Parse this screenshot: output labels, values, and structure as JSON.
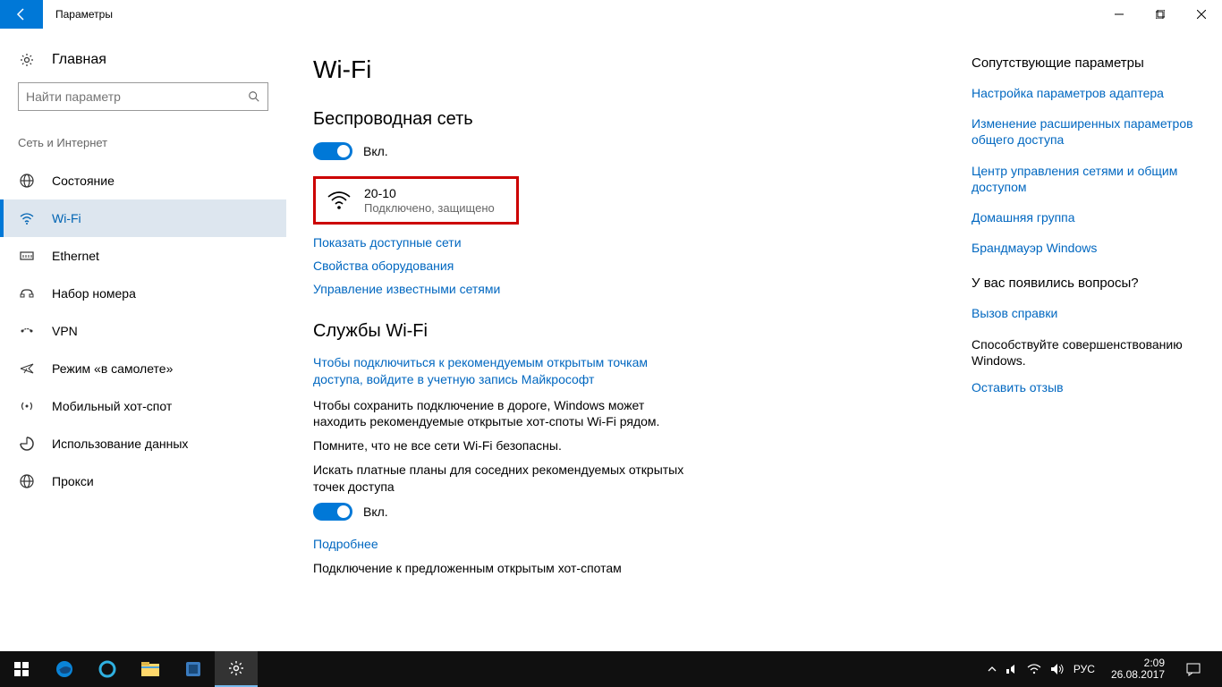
{
  "titlebar": {
    "title": "Параметры"
  },
  "sidebar": {
    "home": "Главная",
    "search_placeholder": "Найти параметр",
    "category": "Сеть и Интернет",
    "items": [
      {
        "label": "Состояние"
      },
      {
        "label": "Wi-Fi"
      },
      {
        "label": "Ethernet"
      },
      {
        "label": "Набор номера"
      },
      {
        "label": "VPN"
      },
      {
        "label": "Режим «в самолете»"
      },
      {
        "label": "Мобильный хот-спот"
      },
      {
        "label": "Использование данных"
      },
      {
        "label": "Прокси"
      }
    ]
  },
  "main": {
    "page_title": "Wi-Fi",
    "wireless_heading": "Беспроводная сеть",
    "toggle_on": "Вкл.",
    "network": {
      "name": "20-10",
      "status": "Подключено, защищено"
    },
    "links": {
      "show_available": "Показать доступные сети",
      "hardware_props": "Свойства оборудования",
      "manage_known": "Управление известными сетями"
    },
    "services_heading": "Службы Wi-Fi",
    "signin_link": "Чтобы подключиться к рекомендуемым открытым точкам доступа, войдите в учетную запись Майкрософт",
    "para1": "Чтобы сохранить подключение в дороге, Windows может находить рекомендуемые открытые хот-споты Wi-Fi рядом.",
    "para2": "Помните, что не все сети Wi-Fi безопасны.",
    "para3": "Искать платные планы для соседних рекомендуемых открытых точек доступа",
    "toggle_on2": "Вкл.",
    "more_link": "Подробнее",
    "para4": "Подключение к предложенным открытым хот-спотам"
  },
  "right": {
    "related_heading": "Сопутствующие параметры",
    "links": [
      "Настройка параметров адаптера",
      "Изменение расширенных параметров общего доступа",
      "Центр управления сетями и общим доступом",
      "Домашняя группа",
      "Брандмауэр Windows"
    ],
    "questions_heading": "У вас появились вопросы?",
    "help_link": "Вызов справки",
    "improve_heading": "Способствуйте совершенствованию Windows.",
    "feedback_link": "Оставить отзыв"
  },
  "taskbar": {
    "lang": "РУС",
    "time": "2:09",
    "date": "26.08.2017"
  }
}
